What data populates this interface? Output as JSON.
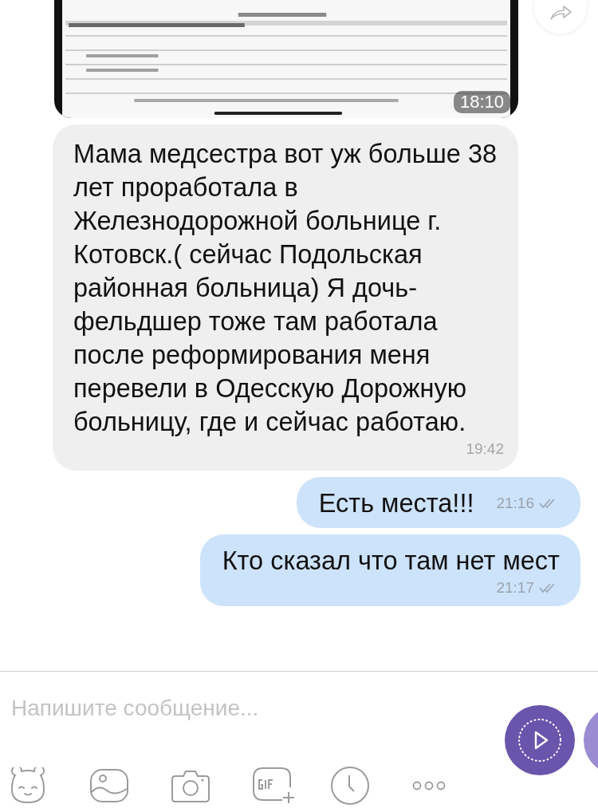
{
  "messages": [
    {
      "kind": "picture",
      "time": "18:10"
    },
    {
      "kind": "incoming",
      "text": "Мама медсестра вот уж больше 38 лет проработала в Железнодорожной больнице г. Котовск.( сейчас Подольская районная больница) Я дочь-фельдшер тоже там работала после реформирования меня перевели в Одесскую Дорожную больницу, где и сейчас работаю.",
      "time": "19:42"
    },
    {
      "kind": "outgoing_short",
      "text": "Есть места!!!",
      "time": "21:16"
    },
    {
      "kind": "outgoing",
      "text": "Кто сказал что там нет мест",
      "time": "21:17"
    }
  ],
  "composer": {
    "placeholder": "Напишите сообщение..."
  }
}
